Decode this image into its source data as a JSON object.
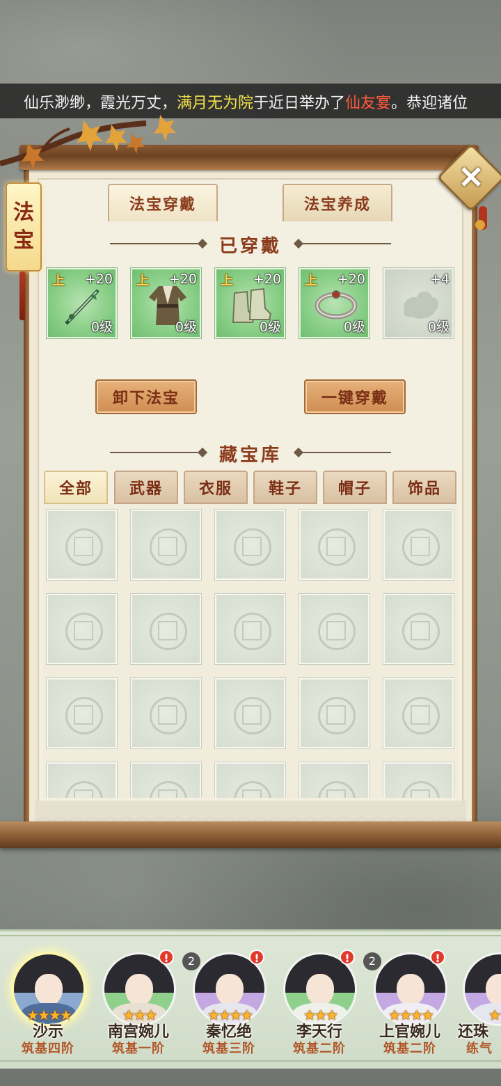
{
  "marquee": {
    "part1": "仙乐渺缈，霞光万丈，",
    "sect": "满月无为院",
    "part2": "于近日举办了",
    "event": "仙友宴",
    "part3": "。恭迎诸位"
  },
  "side_banner": {
    "char1": "法",
    "char2": "宝"
  },
  "close_icon": "close-icon",
  "top_tabs": [
    {
      "label": "法宝穿戴",
      "active": true
    },
    {
      "label": "法宝养成",
      "active": false
    }
  ],
  "equipped": {
    "title": "已穿戴",
    "slots": [
      {
        "grade": "上",
        "plus": "+20",
        "level": "0级",
        "icon": "sword-icon"
      },
      {
        "grade": "上",
        "plus": "+20",
        "level": "0级",
        "icon": "robe-icon"
      },
      {
        "grade": "上",
        "plus": "+20",
        "level": "0级",
        "icon": "boots-icon"
      },
      {
        "grade": "上",
        "plus": "+20",
        "level": "0级",
        "icon": "bracelet-icon"
      },
      {
        "grade": "",
        "plus": "+4",
        "level": "0级",
        "icon": "empty-slot-icon"
      }
    ]
  },
  "buttons": {
    "unequip": "卸下法宝",
    "equip_all": "一键穿戴"
  },
  "storage": {
    "title": "藏宝库",
    "tabs": [
      "全部",
      "武器",
      "衣服",
      "鞋子",
      "帽子",
      "饰品"
    ],
    "active_tab": "全部"
  },
  "characters": [
    {
      "name": "沙示",
      "rank": "筑基四阶",
      "stars": "★★★★",
      "selected": true,
      "count": "",
      "alert": false,
      "color": "#4f6e9b"
    },
    {
      "name": "南宫婉儿",
      "rank": "筑基一阶",
      "stars": "★★★",
      "selected": false,
      "count": "",
      "alert": true,
      "color": "#6fbf74"
    },
    {
      "name": "秦忆绝",
      "rank": "筑基三阶",
      "stars": "★★★★",
      "selected": false,
      "count": "2",
      "alert": true,
      "color": "#b08fd6"
    },
    {
      "name": "李天行",
      "rank": "筑基二阶",
      "stars": "★★★",
      "selected": false,
      "count": "",
      "alert": true,
      "color": "#6fbf74"
    },
    {
      "name": "上官婉儿",
      "rank": "筑基二阶",
      "stars": "★★★★",
      "selected": false,
      "count": "2",
      "alert": true,
      "color": "#b08fd6"
    },
    {
      "name": "还珠",
      "rank": "练气",
      "stars": "★★",
      "selected": false,
      "count": "",
      "alert": false,
      "color": "#b08fd6"
    }
  ],
  "colors": {
    "accent_text": "#8a3c1c",
    "slot_green": "#8fd18c",
    "marquee_yellow": "#f5e24a",
    "marquee_red": "#ff5a3c"
  }
}
